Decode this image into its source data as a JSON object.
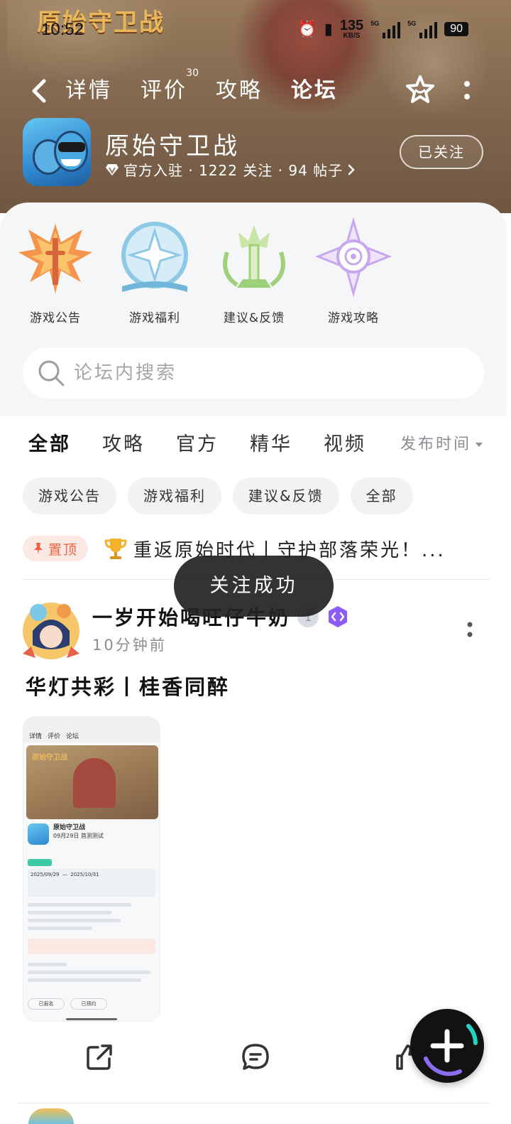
{
  "banner": {
    "logo_text": "原始守卫战"
  },
  "status_bar": {
    "time": "10:52",
    "net_speed": "135",
    "net_unit": "KB/S",
    "signal1_tag": "5G",
    "signal2_tag": "5G",
    "battery": "90"
  },
  "nav": {
    "tabs": [
      {
        "label": "详情"
      },
      {
        "label": "评价",
        "badge": "30"
      },
      {
        "label": "攻略"
      },
      {
        "label": "论坛"
      }
    ],
    "active_tab": "论坛",
    "accent_color": "#24d3c1"
  },
  "game": {
    "name": "原始守卫战",
    "meta": "官方入驻 · 1222 关注 · 94 帖子",
    "follow_label": "已关注"
  },
  "categories": [
    {
      "label": "游戏公告",
      "icon": "wings-sword-icon"
    },
    {
      "label": "游戏福利",
      "icon": "book-emblem-icon"
    },
    {
      "label": "建议&反馈",
      "icon": "tree-emblem-icon"
    },
    {
      "label": "游戏攻略",
      "icon": "eye-star-icon"
    }
  ],
  "search": {
    "placeholder": "论坛内搜索"
  },
  "filter_tabs": [
    {
      "label": "全部"
    },
    {
      "label": "攻略"
    },
    {
      "label": "官方"
    },
    {
      "label": "精华"
    },
    {
      "label": "视频"
    }
  ],
  "sort": {
    "label": "发布时间"
  },
  "chips": [
    {
      "label": "游戏公告"
    },
    {
      "label": "游戏福利"
    },
    {
      "label": "建议&反馈"
    },
    {
      "label": "全部"
    }
  ],
  "pinned": {
    "badge": "置顶",
    "title": "重返原始时代丨守护部落荣光！..."
  },
  "post": {
    "author": "一岁开始喝旺仔牛奶",
    "time": "10分钟前",
    "title": "华灯共彩丨桂香同醉",
    "thumb": {
      "tabs": [
        "详情",
        "评价",
        "论坛"
      ],
      "logo": "原始守卫战",
      "game_name": "原始守卫战",
      "game_sub": "09月29日 首测测试",
      "box_start": "2025/09/29",
      "box_end": "2025/10/31",
      "btn1": "已报名",
      "btn2": "已预约"
    }
  },
  "toast": {
    "message": "关注成功"
  }
}
